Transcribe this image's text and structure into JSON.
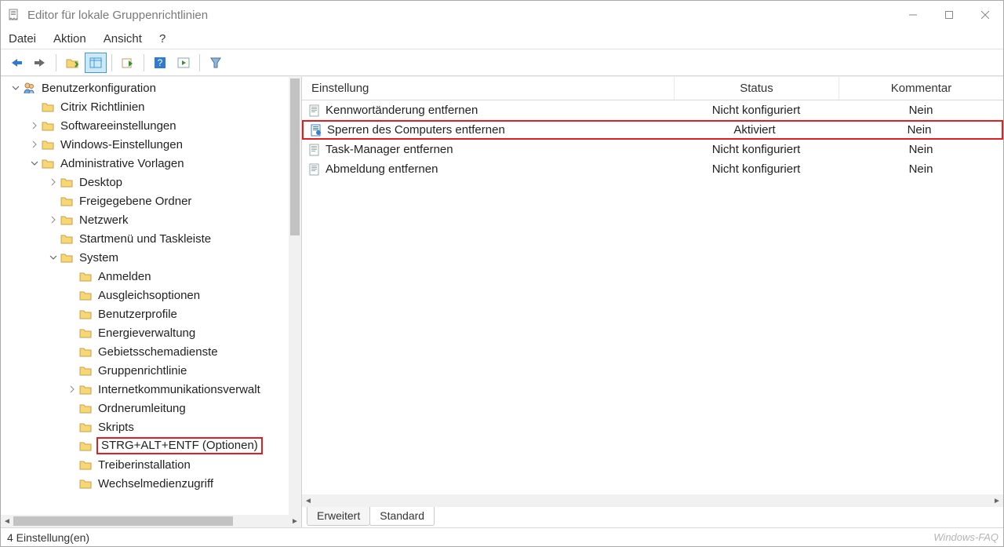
{
  "window": {
    "title": "Editor für lokale Gruppenrichtlinien"
  },
  "menubar": [
    "Datei",
    "Aktion",
    "Ansicht",
    "?"
  ],
  "tree": [
    {
      "indent": 0,
      "expander": "down",
      "icon": "user",
      "label": "Benutzerkonfiguration",
      "highlight": false
    },
    {
      "indent": 1,
      "expander": "",
      "icon": "folder",
      "label": "Citrix Richtlinien"
    },
    {
      "indent": 1,
      "expander": "right",
      "icon": "folder",
      "label": "Softwareeinstellungen"
    },
    {
      "indent": 1,
      "expander": "right",
      "icon": "folder",
      "label": "Windows-Einstellungen"
    },
    {
      "indent": 1,
      "expander": "down",
      "icon": "folder",
      "label": "Administrative Vorlagen"
    },
    {
      "indent": 2,
      "expander": "right",
      "icon": "folder",
      "label": "Desktop"
    },
    {
      "indent": 2,
      "expander": "",
      "icon": "folder",
      "label": "Freigegebene Ordner"
    },
    {
      "indent": 2,
      "expander": "right",
      "icon": "folder",
      "label": "Netzwerk"
    },
    {
      "indent": 2,
      "expander": "",
      "icon": "folder",
      "label": "Startmenü und Taskleiste"
    },
    {
      "indent": 2,
      "expander": "down",
      "icon": "folder",
      "label": "System"
    },
    {
      "indent": 3,
      "expander": "",
      "icon": "folder",
      "label": "Anmelden"
    },
    {
      "indent": 3,
      "expander": "",
      "icon": "folder",
      "label": "Ausgleichsoptionen"
    },
    {
      "indent": 3,
      "expander": "",
      "icon": "folder",
      "label": "Benutzerprofile"
    },
    {
      "indent": 3,
      "expander": "",
      "icon": "folder",
      "label": "Energieverwaltung"
    },
    {
      "indent": 3,
      "expander": "",
      "icon": "folder",
      "label": "Gebietsschemadienste"
    },
    {
      "indent": 3,
      "expander": "",
      "icon": "folder",
      "label": "Gruppenrichtlinie"
    },
    {
      "indent": 3,
      "expander": "right",
      "icon": "folder",
      "label": "Internetkommunikationsverwalt"
    },
    {
      "indent": 3,
      "expander": "",
      "icon": "folder",
      "label": "Ordnerumleitung"
    },
    {
      "indent": 3,
      "expander": "",
      "icon": "folder",
      "label": "Skripts"
    },
    {
      "indent": 3,
      "expander": "",
      "icon": "folder",
      "label": "STRG+ALT+ENTF (Optionen)",
      "highlight": true
    },
    {
      "indent": 3,
      "expander": "",
      "icon": "folder",
      "label": "Treiberinstallation"
    },
    {
      "indent": 3,
      "expander": "",
      "icon": "folder",
      "label": "Wechselmedienzugriff"
    }
  ],
  "details": {
    "columns": {
      "setting": "Einstellung",
      "status": "Status",
      "comment": "Kommentar"
    },
    "rows": [
      {
        "icon": "policy",
        "setting": "Kennwortänderung entfernen",
        "status": "Nicht konfiguriert",
        "comment": "Nein",
        "highlight": false
      },
      {
        "icon": "policy-active",
        "setting": "Sperren des Computers entfernen",
        "status": "Aktiviert",
        "comment": "Nein",
        "highlight": true
      },
      {
        "icon": "policy",
        "setting": "Task-Manager entfernen",
        "status": "Nicht konfiguriert",
        "comment": "Nein",
        "highlight": false
      },
      {
        "icon": "policy",
        "setting": "Abmeldung entfernen",
        "status": "Nicht konfiguriert",
        "comment": "Nein",
        "highlight": false
      }
    ]
  },
  "tabs": {
    "extended": "Erweitert",
    "standard": "Standard"
  },
  "statusbar": {
    "count": "4 Einstellung(en)",
    "watermark": "Windows-FAQ"
  }
}
